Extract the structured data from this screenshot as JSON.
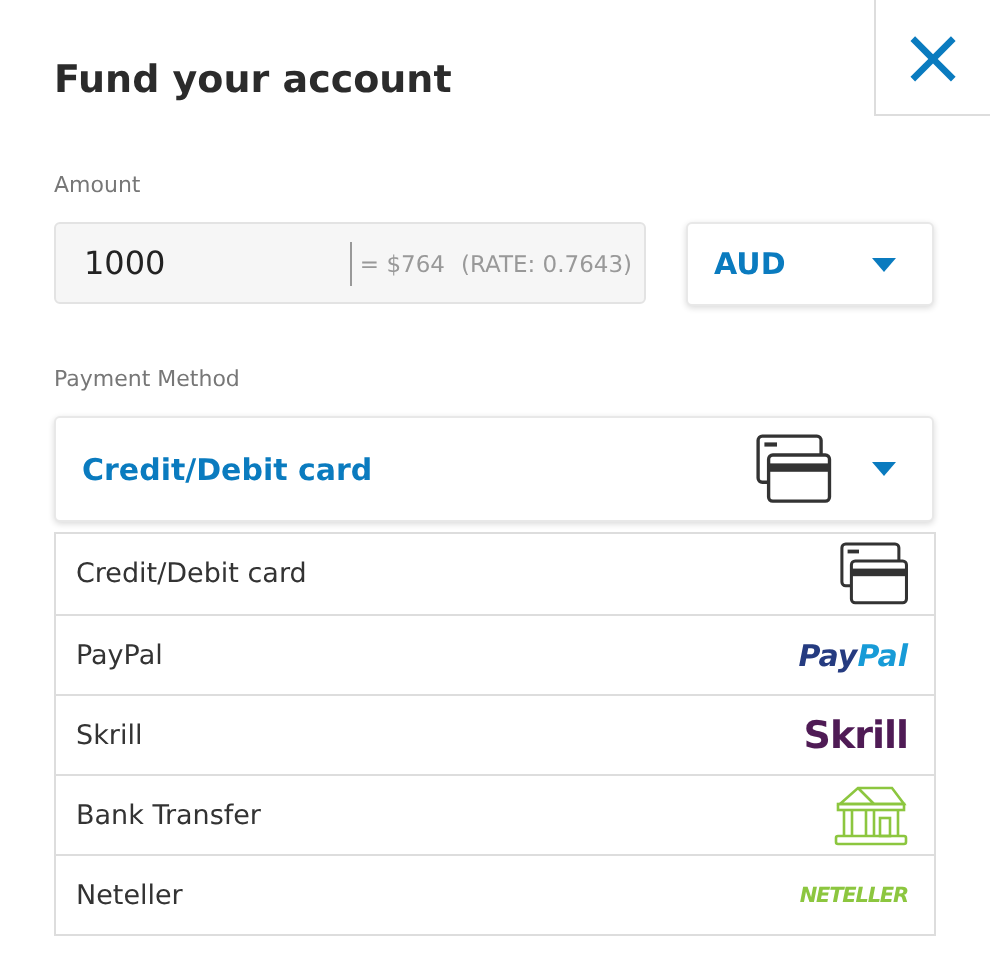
{
  "title": "Fund your account",
  "close": {
    "label": "×"
  },
  "amount": {
    "label": "Amount",
    "value": "1000",
    "conversion": "= $764",
    "rate": "(RATE: 0.7643)"
  },
  "currency": {
    "value": "AUD"
  },
  "payment": {
    "label": "Payment Method",
    "value": "Credit/Debit card",
    "kind": "card"
  },
  "options": [
    {
      "label": "Credit/Debit card",
      "kind": "card"
    },
    {
      "label": "PayPal",
      "kind": "paypal",
      "logo": "PayPal"
    },
    {
      "label": "Skrill",
      "kind": "skrill",
      "logo": "Skrill"
    },
    {
      "label": "Bank Transfer",
      "kind": "bank"
    },
    {
      "label": "Neteller",
      "kind": "neteller",
      "logo": "NETELLER"
    }
  ]
}
